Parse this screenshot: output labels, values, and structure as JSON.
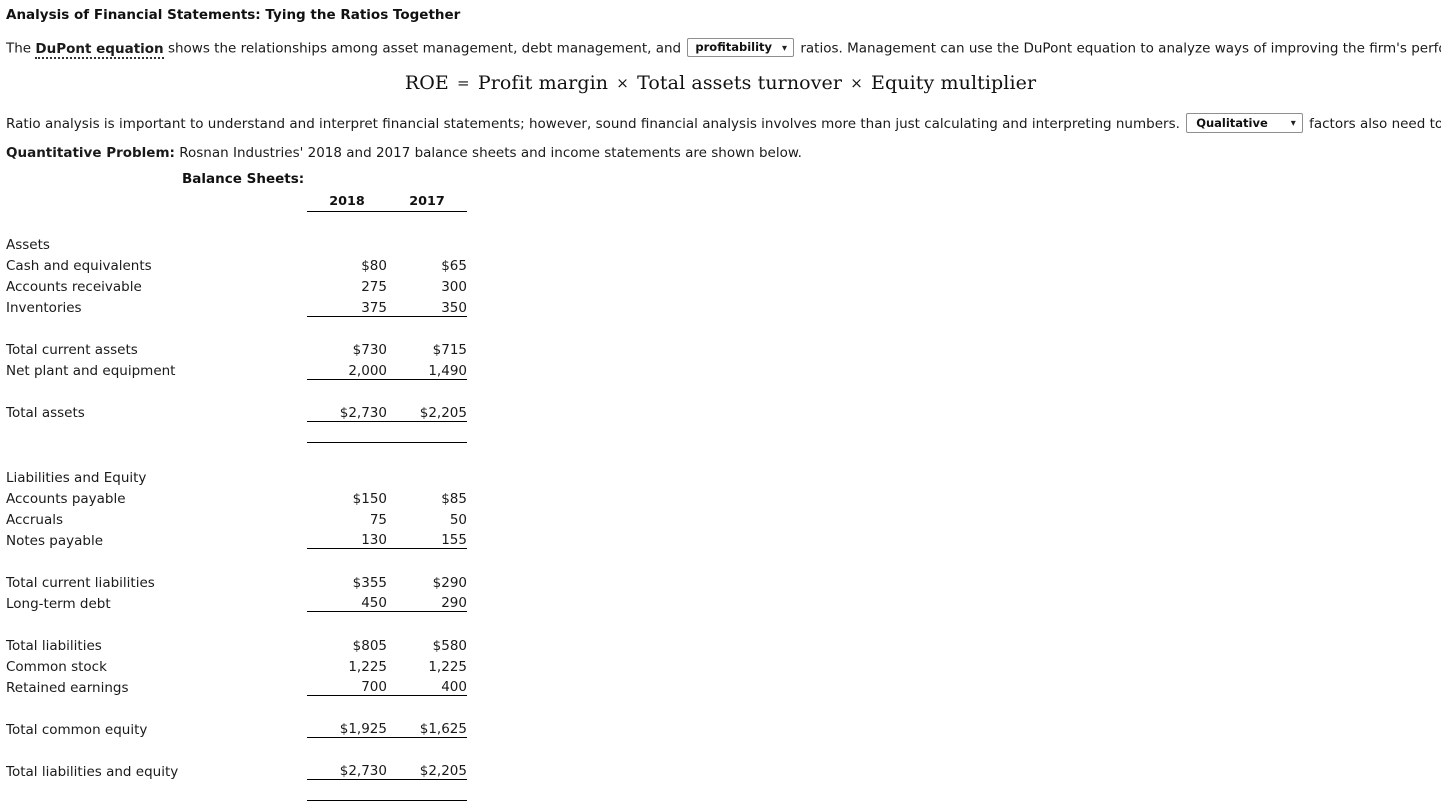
{
  "page_title": "Analysis of Financial Statements: Tying the Ratios Together",
  "paragraph1": {
    "part1": "The ",
    "term": "DuPont equation",
    "part2": " shows the relationships among asset management, debt management, and ",
    "dropdown_value": "profitability",
    "part3": " ratios. Management can use the DuPont equation to analyze ways of improving the firm's performance. Its equation is:"
  },
  "equation": {
    "lhs": "ROE",
    "eq": "=",
    "term1": "Profit margin",
    "op1": "×",
    "term2": "Total assets turnover",
    "op2": "×",
    "term3": "Equity multiplier"
  },
  "paragraph2": {
    "part1": "Ratio analysis is important to understand and interpret financial statements; however, sound financial analysis involves more than just calculating and interpreting numbers. ",
    "dropdown_value": "Qualitative",
    "part2": " factors also need to be considered."
  },
  "paragraph3": {
    "label": "Quantitative Problem:",
    "text": " Rosnan Industries' 2018 and 2017 balance sheets and income statements are shown below."
  },
  "chevron_glyph": "⌄",
  "balance_sheet": {
    "heading": "Balance Sheets:",
    "columns": [
      "2018",
      "2017"
    ],
    "sections": [
      {
        "title": "Assets",
        "rows": [
          {
            "label": "Cash and equivalents",
            "indent": 0,
            "values": [
              "$80",
              "$65"
            ],
            "rule": "none"
          },
          {
            "label": "Accounts receivable",
            "indent": 0,
            "values": [
              "275",
              "300"
            ],
            "rule": "none"
          },
          {
            "label": "Inventories",
            "indent": 0,
            "values": [
              "375",
              "350"
            ],
            "rule": "single"
          },
          {
            "label": "Total current assets",
            "indent": 2,
            "values": [
              "$730",
              "$715"
            ],
            "rule": "none"
          },
          {
            "label": "Net plant and equipment",
            "indent": 0,
            "values": [
              "2,000",
              "1,490"
            ],
            "rule": "single"
          },
          {
            "label": "Total assets",
            "indent": 0,
            "values": [
              "$2,730",
              "$2,205"
            ],
            "rule": "double"
          }
        ]
      },
      {
        "title": "Liabilities and Equity",
        "rows": [
          {
            "label": "Accounts payable",
            "indent": 0,
            "values": [
              "$150",
              "$85"
            ],
            "rule": "none"
          },
          {
            "label": "Accruals",
            "indent": 0,
            "values": [
              "75",
              "50"
            ],
            "rule": "none"
          },
          {
            "label": "Notes payable",
            "indent": 0,
            "values": [
              "130",
              "155"
            ],
            "rule": "single"
          },
          {
            "label": "Total current liabilities",
            "indent": 2,
            "values": [
              "$355",
              "$290"
            ],
            "rule": "none"
          },
          {
            "label": "Long-term debt",
            "indent": 0,
            "values": [
              "450",
              "290"
            ],
            "rule": "single"
          },
          {
            "label": "Total liabilities",
            "indent": 2,
            "values": [
              "$805",
              "$580"
            ],
            "rule": "none"
          },
          {
            "label": "Common stock",
            "indent": 0,
            "values": [
              "1,225",
              "1,225"
            ],
            "rule": "none"
          },
          {
            "label": "Retained earnings",
            "indent": 0,
            "values": [
              "700",
              "400"
            ],
            "rule": "single"
          },
          {
            "label": "Total common equity",
            "indent": 2,
            "values": [
              "$1,925",
              "$1,625"
            ],
            "rule": "single"
          },
          {
            "label": "Total liabilities and equity",
            "indent": 0,
            "values": [
              "$2,730",
              "$2,205"
            ],
            "rule": "double"
          }
        ]
      }
    ]
  }
}
